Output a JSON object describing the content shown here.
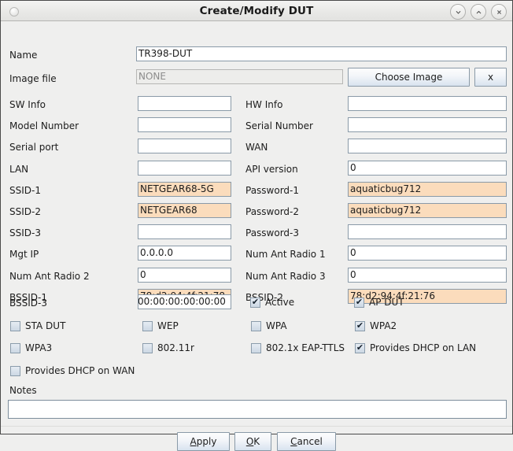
{
  "window": {
    "title": "Create/Modify DUT",
    "controls": [
      {
        "name": "minimize",
        "glyph": "chevron-down"
      },
      {
        "name": "maximize",
        "glyph": "chevron-up"
      },
      {
        "name": "close",
        "glyph": "x"
      }
    ]
  },
  "form": {
    "name": {
      "label": "Name",
      "value": "TR398-DUT"
    },
    "image_file": {
      "label": "Image file",
      "value": "NONE",
      "choose_button": "Choose Image",
      "clear_button": "x"
    },
    "rows": [
      {
        "left_label": "SW Info",
        "left_value": "",
        "left_mod": false,
        "right_label": "HW Info",
        "right_value": "",
        "right_mod": false
      },
      {
        "left_label": "Model Number",
        "left_value": "",
        "left_mod": false,
        "right_label": "Serial Number",
        "right_value": "",
        "right_mod": false
      },
      {
        "left_label": "Serial port",
        "left_value": "",
        "left_mod": false,
        "right_label": "WAN",
        "right_value": "",
        "right_mod": false
      },
      {
        "left_label": "LAN",
        "left_value": "",
        "left_mod": false,
        "right_label": "API version",
        "right_value": "0",
        "right_mod": false
      },
      {
        "left_label": "SSID-1",
        "left_value": "NETGEAR68-5G",
        "left_mod": true,
        "right_label": "Password-1",
        "right_value": "aquaticbug712",
        "right_mod": true
      },
      {
        "left_label": "SSID-2",
        "left_value": "NETGEAR68",
        "left_mod": true,
        "right_label": "Password-2",
        "right_value": "aquaticbug712",
        "right_mod": true
      },
      {
        "left_label": "SSID-3",
        "left_value": "",
        "left_mod": false,
        "right_label": "Password-3",
        "right_value": "",
        "right_mod": false
      },
      {
        "left_label": "Mgt IP",
        "left_value": "0.0.0.0",
        "left_mod": false,
        "right_label": "Num Ant Radio 1",
        "right_value": "0",
        "right_mod": false
      },
      {
        "left_label": "Num Ant Radio 2",
        "left_value": "0",
        "left_mod": false,
        "right_label": "Num Ant Radio 3",
        "right_value": "0",
        "right_mod": false
      },
      {
        "left_label": "BSSID-1",
        "left_value": "78:d2:94:4f:21:78",
        "left_mod": true,
        "right_label": "BSSID-2",
        "right_value": "78:d2:94:4f:21:76",
        "right_mod": true
      }
    ],
    "bssid3": {
      "label": "BSSID-3",
      "value": "00:00:00:00:00:00"
    },
    "inline_checks": [
      {
        "label": "Active",
        "checked": true
      },
      {
        "label": "AP DUT",
        "checked": true
      }
    ],
    "checkboxes": [
      {
        "label": "STA DUT",
        "checked": false
      },
      {
        "label": "WEP",
        "checked": false
      },
      {
        "label": "WPA",
        "checked": false
      },
      {
        "label": "WPA2",
        "checked": true
      },
      {
        "label": "WPA3",
        "checked": false
      },
      {
        "label": "802.11r",
        "checked": false
      },
      {
        "label": "802.1x EAP-TTLS",
        "checked": false
      },
      {
        "label": "Provides DHCP on LAN",
        "checked": true
      },
      {
        "label": "Provides DHCP on WAN",
        "checked": false
      }
    ],
    "notes": {
      "label": "Notes",
      "value": "",
      "placeholder": ""
    }
  },
  "actions": {
    "apply": {
      "mnemonic": "A",
      "rest": "pply"
    },
    "ok": {
      "mnemonic": "O",
      "rest": "K"
    },
    "cancel": {
      "mnemonic": "C",
      "rest": "ancel"
    }
  },
  "colors": {
    "modified_field": "#fbdcbc",
    "field_border": "#8a9aa8",
    "window_bg": "#efefee"
  }
}
